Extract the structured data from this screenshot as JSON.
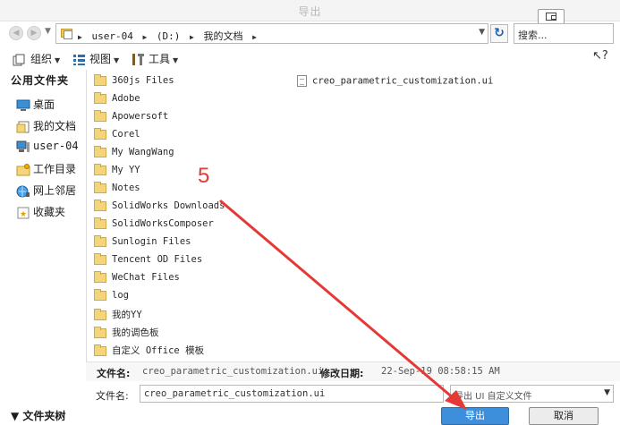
{
  "window": {
    "title": "导出"
  },
  "address": {
    "crumbs": [
      "user-04",
      "(D:)",
      "我的文档"
    ]
  },
  "search": {
    "placeholder": "搜索..."
  },
  "toolbar": {
    "organize": "组织",
    "views": "视图",
    "tools": "工具"
  },
  "sidebar": {
    "title": "公用文件夹",
    "items": [
      {
        "label": "桌面",
        "icon": "desktop-icon"
      },
      {
        "label": "我的文档",
        "icon": "documents-icon"
      },
      {
        "label": "user-04",
        "icon": "computer-icon"
      },
      {
        "label": "工作目录",
        "icon": "working-dir-icon"
      },
      {
        "label": "网上邻居",
        "icon": "network-icon"
      },
      {
        "label": "收藏夹",
        "icon": "favorites-icon"
      }
    ]
  },
  "files": {
    "folders": [
      "360js Files",
      "Adobe",
      "Apowersoft",
      "Corel",
      "My WangWang",
      "My YY",
      "Notes",
      "SolidWorks Downloads",
      "SolidWorksComposer",
      "Sunlogin Files",
      "Tencent OD Files",
      "WeChat Files",
      "log",
      "我的YY",
      "我的调色板",
      "自定义 Office 模板"
    ],
    "docs": [
      "creo_parametric_customization.ui"
    ]
  },
  "details": {
    "name_label": "文件名:",
    "name_value": "creo_parametric_customization.ui",
    "date_label": "修改日期:",
    "date_value": "22-Sep-19 08:58:15 AM"
  },
  "filename": {
    "label": "文件名:",
    "value": "creo_parametric_customization.ui"
  },
  "type_select": {
    "value": "导出 UI 自定义文件"
  },
  "footer": {
    "folders_toggle": "文件夹树",
    "save": "导出",
    "cancel": "取消"
  },
  "annotation": {
    "number": "5",
    "color": "#e53935"
  }
}
